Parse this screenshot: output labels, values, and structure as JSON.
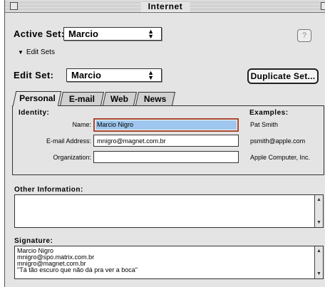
{
  "window": {
    "title": "Internet"
  },
  "active_set": {
    "label": "Active Set:",
    "value": "Marcio"
  },
  "help": {
    "label": "?"
  },
  "disclosure": {
    "label": "Edit Sets"
  },
  "edit_set": {
    "label": "Edit Set:",
    "value": "Marcio",
    "duplicate_label": "Duplicate Set..."
  },
  "tabs": [
    {
      "label": "Personal",
      "active": true
    },
    {
      "label": "E-mail",
      "active": false
    },
    {
      "label": "Web",
      "active": false
    },
    {
      "label": "News",
      "active": false
    }
  ],
  "identity": {
    "heading": "Identity:",
    "examples_heading": "Examples:",
    "fields": [
      {
        "label": "Name:",
        "value": "Marcio Nigro",
        "example": "Pat Smith"
      },
      {
        "label": "E-mail Address:",
        "value": "mnigro@magnet.com.br",
        "example": "psmith@apple.com"
      },
      {
        "label": "Organization:",
        "value": "",
        "example": "Apple Computer, Inc."
      }
    ]
  },
  "other_information": {
    "label": "Other Information:",
    "value": ""
  },
  "signature": {
    "label": "Signature:",
    "lines": [
      "Marcio Nigro",
      "mnigro@spo.matrix.com.br",
      "mnigro@magnet.com.br",
      "\"Tá tão escuro que não dá pra ver a boca\""
    ]
  }
}
